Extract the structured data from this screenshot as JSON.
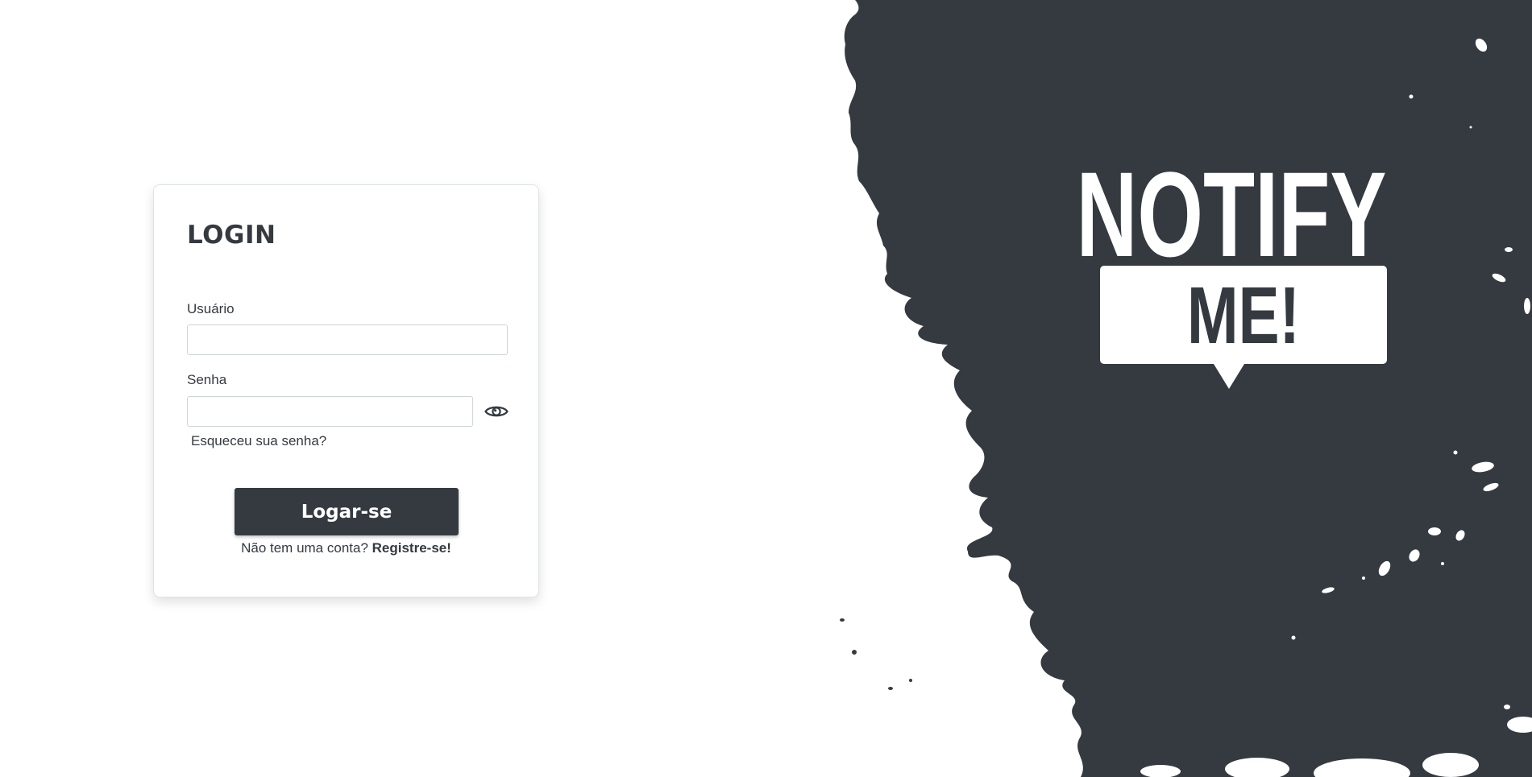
{
  "login": {
    "title": "LOGIN",
    "username_label": "Usuário",
    "username_value": "",
    "password_label": "Senha",
    "password_value": "",
    "forgot_password": "Esqueceu sua senha?",
    "submit_label": "Logar-se",
    "register_prompt": "Não tem uma conta?",
    "register_link": "Registre-se!",
    "show_password_icon": "eye-icon"
  },
  "logo": {
    "line1": "NOTIFY",
    "line2": "ME!"
  },
  "colors": {
    "primary": "#343a40",
    "background": "#ffffff",
    "border": "#ced4da"
  }
}
